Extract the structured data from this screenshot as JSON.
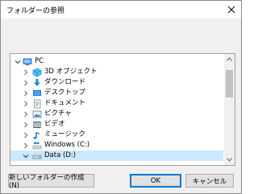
{
  "dialog": {
    "title": "フォルダーの参照"
  },
  "tree": {
    "items": [
      {
        "label": "PC",
        "icon": "pc-icon",
        "expanded": true
      },
      {
        "label": "3D オブジェクト",
        "icon": "3d-objects-icon"
      },
      {
        "label": "ダウンロード",
        "icon": "download-folder-icon"
      },
      {
        "label": "デスクトップ",
        "icon": "desktop-folder-icon"
      },
      {
        "label": "ドキュメント",
        "icon": "documents-folder-icon"
      },
      {
        "label": "ピクチャ",
        "icon": "pictures-folder-icon"
      },
      {
        "label": "ビデオ",
        "icon": "videos-folder-icon"
      },
      {
        "label": "ミュージック",
        "icon": "music-folder-icon"
      },
      {
        "label": "Windows (C:)",
        "icon": "windows-drive-icon"
      },
      {
        "label": "Data (D:)",
        "icon": "drive-icon",
        "expanded": true,
        "selected": true
      }
    ]
  },
  "buttons": {
    "new_folder": "新しいフォルダーの作成(N)",
    "ok": "OK",
    "cancel": "キャンセル"
  },
  "colors": {
    "selection": "#cce8ff",
    "accent": "#0078d7",
    "dialog_bg": "#f0f0f0"
  }
}
